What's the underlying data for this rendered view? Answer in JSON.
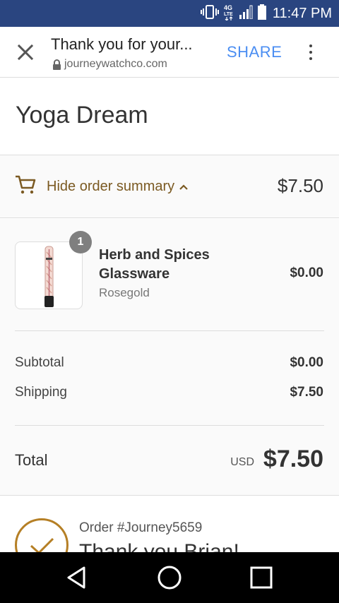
{
  "status_bar": {
    "time": "11:47 PM",
    "network": "4G LTE"
  },
  "toolbar": {
    "title": "Thank you for your...",
    "url": "journeywatchco.com",
    "share_label": "SHARE"
  },
  "store": {
    "name": "Yoga Dream"
  },
  "summary_toggle": {
    "label": "Hide order summary",
    "total": "$7.50"
  },
  "order_summary": {
    "items": [
      {
        "quantity": "1",
        "name": "Herb and Spices Glassware",
        "variant": "Rosegold",
        "price": "$0.00"
      }
    ],
    "subtotal_label": "Subtotal",
    "subtotal_value": "$0.00",
    "shipping_label": "Shipping",
    "shipping_value": "$7.50",
    "total_label": "Total",
    "total_currency": "USD",
    "total_value": "$7.50"
  },
  "order": {
    "number": "Order #Journey5659",
    "thank_you": "Thank you Brian!"
  },
  "colors": {
    "status_bar": "#2a4580",
    "accent_link": "#4b8ef2",
    "brand_brown": "#7b5a22",
    "check_gold": "#b57f25"
  }
}
